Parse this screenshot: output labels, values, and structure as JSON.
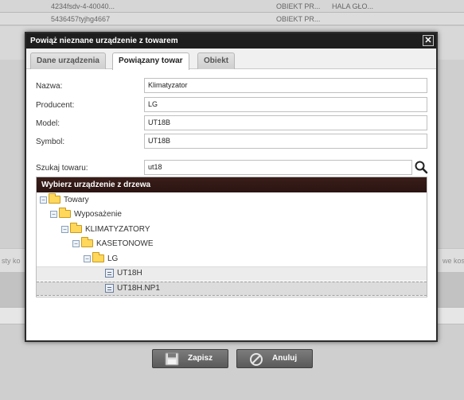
{
  "background": {
    "rows": [
      {
        "code": "4234fsdv-4-40040...",
        "type": "OBIEKT PR...",
        "location": "HALA GŁO..."
      },
      {
        "code": "5436457tyjhg4667",
        "type": "OBIEKT PR...",
        "location": ""
      }
    ],
    "left_side_text": "sty ko",
    "right_side_text": "we kos"
  },
  "dialog": {
    "title": "Powiąż nieznane urządzenie z towarem",
    "close_symbol": "✕",
    "tabs": [
      {
        "label": "Dane urządzenia",
        "active": false
      },
      {
        "label": "Powiązany towar",
        "active": true
      },
      {
        "label": "Obiekt",
        "active": false
      }
    ],
    "fields": {
      "nazwa": {
        "label": "Nazwa:",
        "value": "Klimatyzator"
      },
      "producent": {
        "label": "Producent:",
        "value": "LG"
      },
      "model": {
        "label": "Model:",
        "value": "UT18B"
      },
      "symbol": {
        "label": "Symbol:",
        "value": "UT18B"
      },
      "search": {
        "label": "Szukaj towaru:",
        "value": "ut18"
      }
    },
    "tree": {
      "header": "Wybierz urządzenie z drzewa",
      "nodes": [
        "Towary",
        "Wyposażenie",
        "KLIMATYZATORY",
        "KASETONOWE",
        "LG",
        "UT18H",
        "UT18H.NP1"
      ]
    },
    "buttons": {
      "save": "Zapisz",
      "cancel": "Anuluj"
    }
  }
}
